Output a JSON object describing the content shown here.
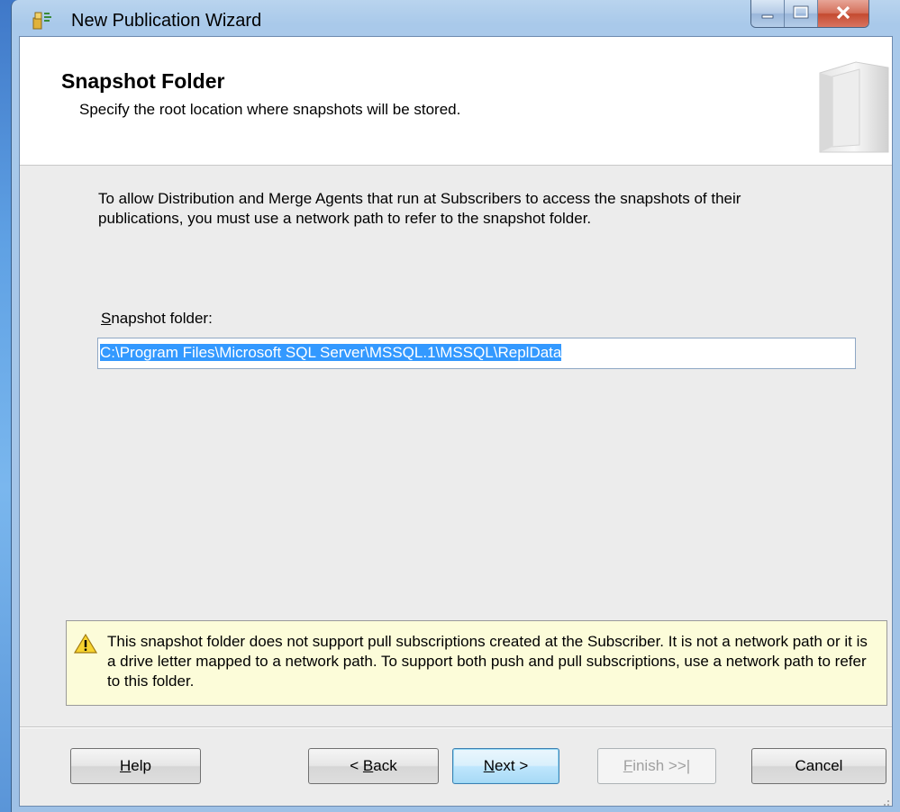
{
  "window": {
    "title": "New Publication Wizard"
  },
  "header": {
    "title": "Snapshot Folder",
    "subtitle": "Specify the root location where snapshots will be stored."
  },
  "body": {
    "intro": "To allow Distribution and Merge Agents that run at Subscribers to access the snapshots of their publications, you must use a network path to refer to the snapshot folder.",
    "field_label": "Snapshot folder:",
    "field_value": "C:\\Program Files\\Microsoft SQL Server\\MSSQL.1\\MSSQL\\ReplData"
  },
  "warning": {
    "icon": "warning-icon",
    "text": "This snapshot folder does not support pull subscriptions created at the Subscriber. It is not a network path or it is a drive letter mapped to a network path. To support both push and pull subscriptions, use a network path to refer to this folder."
  },
  "buttons": {
    "help": "Help",
    "back": "< Back",
    "next": "Next >",
    "finish": "Finish >>|",
    "cancel": "Cancel"
  },
  "colors": {
    "selection": "#3399ff",
    "warning_bg": "#fcfcd9",
    "close_button": "#c44a30"
  }
}
